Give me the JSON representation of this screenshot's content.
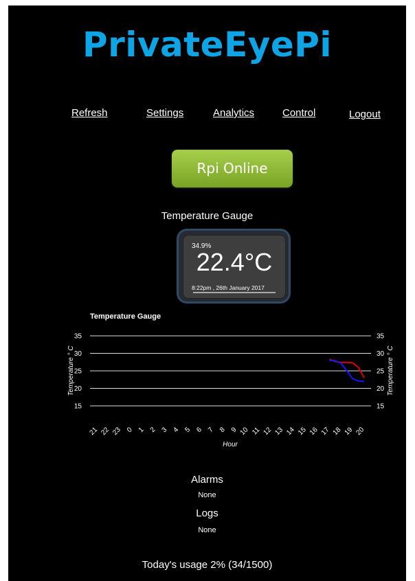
{
  "app": {
    "title": "PrivateEyePi"
  },
  "nav": {
    "items": [
      "Refresh",
      "Settings",
      "Analytics",
      "Control",
      "Logout"
    ]
  },
  "status": {
    "label": "Rpi Online",
    "color": "#8bbd3a"
  },
  "gauge": {
    "title": "Temperature Gauge",
    "humidity": "34.9%",
    "temperature": "22.4°C",
    "timestamp": "8:22pm , 26th January 2017"
  },
  "chart_data": {
    "type": "line",
    "title": "Temperature Gauge",
    "xlabel": "Hour",
    "ylabel": "Temperature ° C",
    "ylabel_right": "Temperature ° C",
    "ylim": [
      15,
      35
    ],
    "yticks": [
      15,
      20,
      25,
      30,
      35
    ],
    "categories": [
      "21",
      "22",
      "23",
      "0",
      "1",
      "2",
      "3",
      "4",
      "5",
      "6",
      "7",
      "8",
      "9",
      "10",
      "11",
      "12",
      "13",
      "14",
      "15",
      "16",
      "17",
      "18",
      "19",
      "20"
    ],
    "grid": true,
    "series": [
      {
        "color": "#e00000",
        "x": [
          17,
          17.5,
          18,
          18.5,
          19,
          19.5,
          20
        ],
        "values": [
          28.3,
          27.7,
          27.4,
          27.4,
          27.3,
          26.0,
          23.0
        ]
      },
      {
        "color": "#1515ff",
        "x": [
          17,
          17.5,
          18,
          18.5,
          19,
          19.5,
          20
        ],
        "values": [
          28.0,
          27.9,
          27.2,
          25.0,
          22.8,
          22.1,
          22.0
        ]
      }
    ]
  },
  "alarms": {
    "title": "Alarms",
    "value": "None"
  },
  "logs": {
    "title": "Logs",
    "value": "None"
  },
  "usage": {
    "text": "Today's usage 2% (34/1500)"
  }
}
